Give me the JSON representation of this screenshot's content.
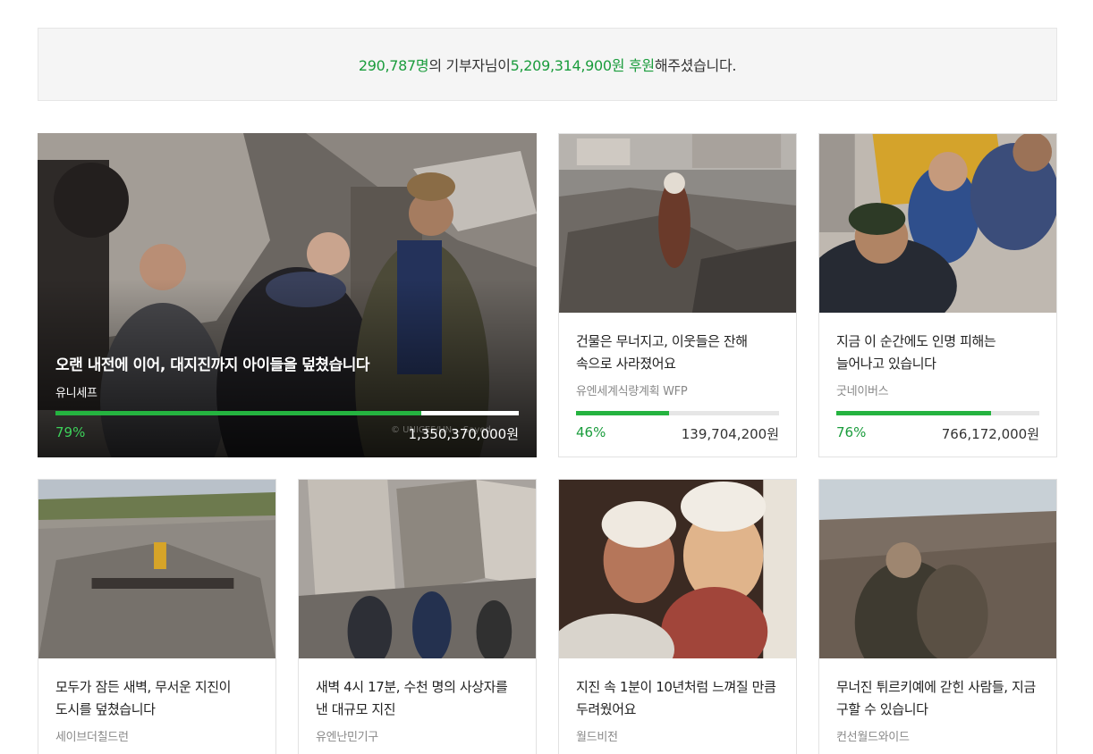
{
  "summary": {
    "donor_count": "290,787명",
    "text_mid": "의 기부자님이 ",
    "total_amount": "5,209,314,900원 후원",
    "text_end": "해주셨습니다."
  },
  "featured": {
    "title": "오랜 내전에 이어, 대지진까지 아이들을 덮쳤습니다",
    "org": "유니세프",
    "percent_label": "79%",
    "progress": 0.79,
    "amount": "1,350,370,000원",
    "photo_credit": "© UNICEF/UN... Sayed"
  },
  "cards": [
    {
      "title": "건물은 무너지고, 이웃들은 잔해 속으로 사라졌어요",
      "org": "유엔세계식량계획 WFP",
      "percent_label": "46%",
      "progress": 0.46,
      "amount": "139,704,200원"
    },
    {
      "title": "지금 이 순간에도 인명 피해는 늘어나고 있습니다",
      "org": "굿네이버스",
      "percent_label": "76%",
      "progress": 0.76,
      "amount": "766,172,000원"
    },
    {
      "title": "모두가 잠든 새벽, 무서운 지진이 도시를 덮쳤습니다",
      "org": "세이브더칠드런"
    },
    {
      "title": "새벽 4시 17분, 수천 명의 사상자를 낸 대규모 지진",
      "org": "유엔난민기구"
    },
    {
      "title": "지진 속 1분이 10년처럼 느껴질 만큼 두려웠어요",
      "org": "월드비전"
    },
    {
      "title": "무너진 튀르키예에 갇힌 사람들, 지금 구할 수 있습니다",
      "org": "컨선월드와이드"
    }
  ],
  "colors": {
    "accent": "#25b340",
    "accent_text": "#1a9c3c"
  }
}
